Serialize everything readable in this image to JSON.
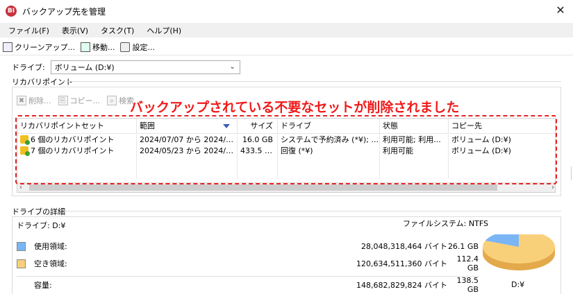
{
  "window": {
    "title": "バックアップ先を管理",
    "app_icon_text": "BI"
  },
  "menu": [
    {
      "label": "ファイル(F)"
    },
    {
      "label": "表示(V)"
    },
    {
      "label": "タスク(T)"
    },
    {
      "label": "ヘルプ(H)"
    }
  ],
  "toolbar": {
    "cleanup_label": "クリーンアップ...",
    "move_label": "移動...",
    "settings_label": "設定..."
  },
  "drive_select": {
    "label": "ドライブ:",
    "value": "ボリューム (D:¥)"
  },
  "recovery_points": {
    "group_label": "リカバリポイント",
    "delete_label": "削除...",
    "copy_label": "コピー...",
    "search_label": "検索..."
  },
  "banner": {
    "text": "バックアップされている不要なセットが削除されました",
    "color": "#f01a1a"
  },
  "table": {
    "columns": [
      "リカバリポイントセット",
      "範囲",
      "サイズ",
      "ドライブ",
      "状態",
      "コピー先"
    ],
    "rows": [
      [
        "6 個のリカバリポイント",
        "2024/07/07 から 2024/07...",
        "16.0 GB",
        "システムで予約済み (*¥); ...",
        "利用可能; 利用...",
        "ボリューム (D:¥)"
      ],
      [
        "7 個のリカバリポイント",
        "2024/05/23 から 2024/05...",
        "433.5 M...",
        "回復 (*¥)",
        "利用可能",
        "ボリューム (D:¥)"
      ]
    ]
  },
  "drive_details": {
    "group_label": "ドライブの詳細",
    "drive": "ドライブ: D:¥",
    "filesystem": "ファイルシステム: NTFS",
    "used": {
      "label": "使用領域:",
      "bytes": "28,048,318,464 バイト",
      "gb": "26.1 GB",
      "color": "#7ab6f5"
    },
    "free": {
      "label": "空き領域:",
      "bytes": "120,634,511,360 バイト",
      "gb": "112.4 GB",
      "color": "#f9d07a"
    },
    "capacity": {
      "label": "容量:",
      "bytes": "148,682,829,824 バイト",
      "gb": "138.5 GB"
    },
    "pie_label": "D:¥",
    "used_fraction": 0.189
  }
}
